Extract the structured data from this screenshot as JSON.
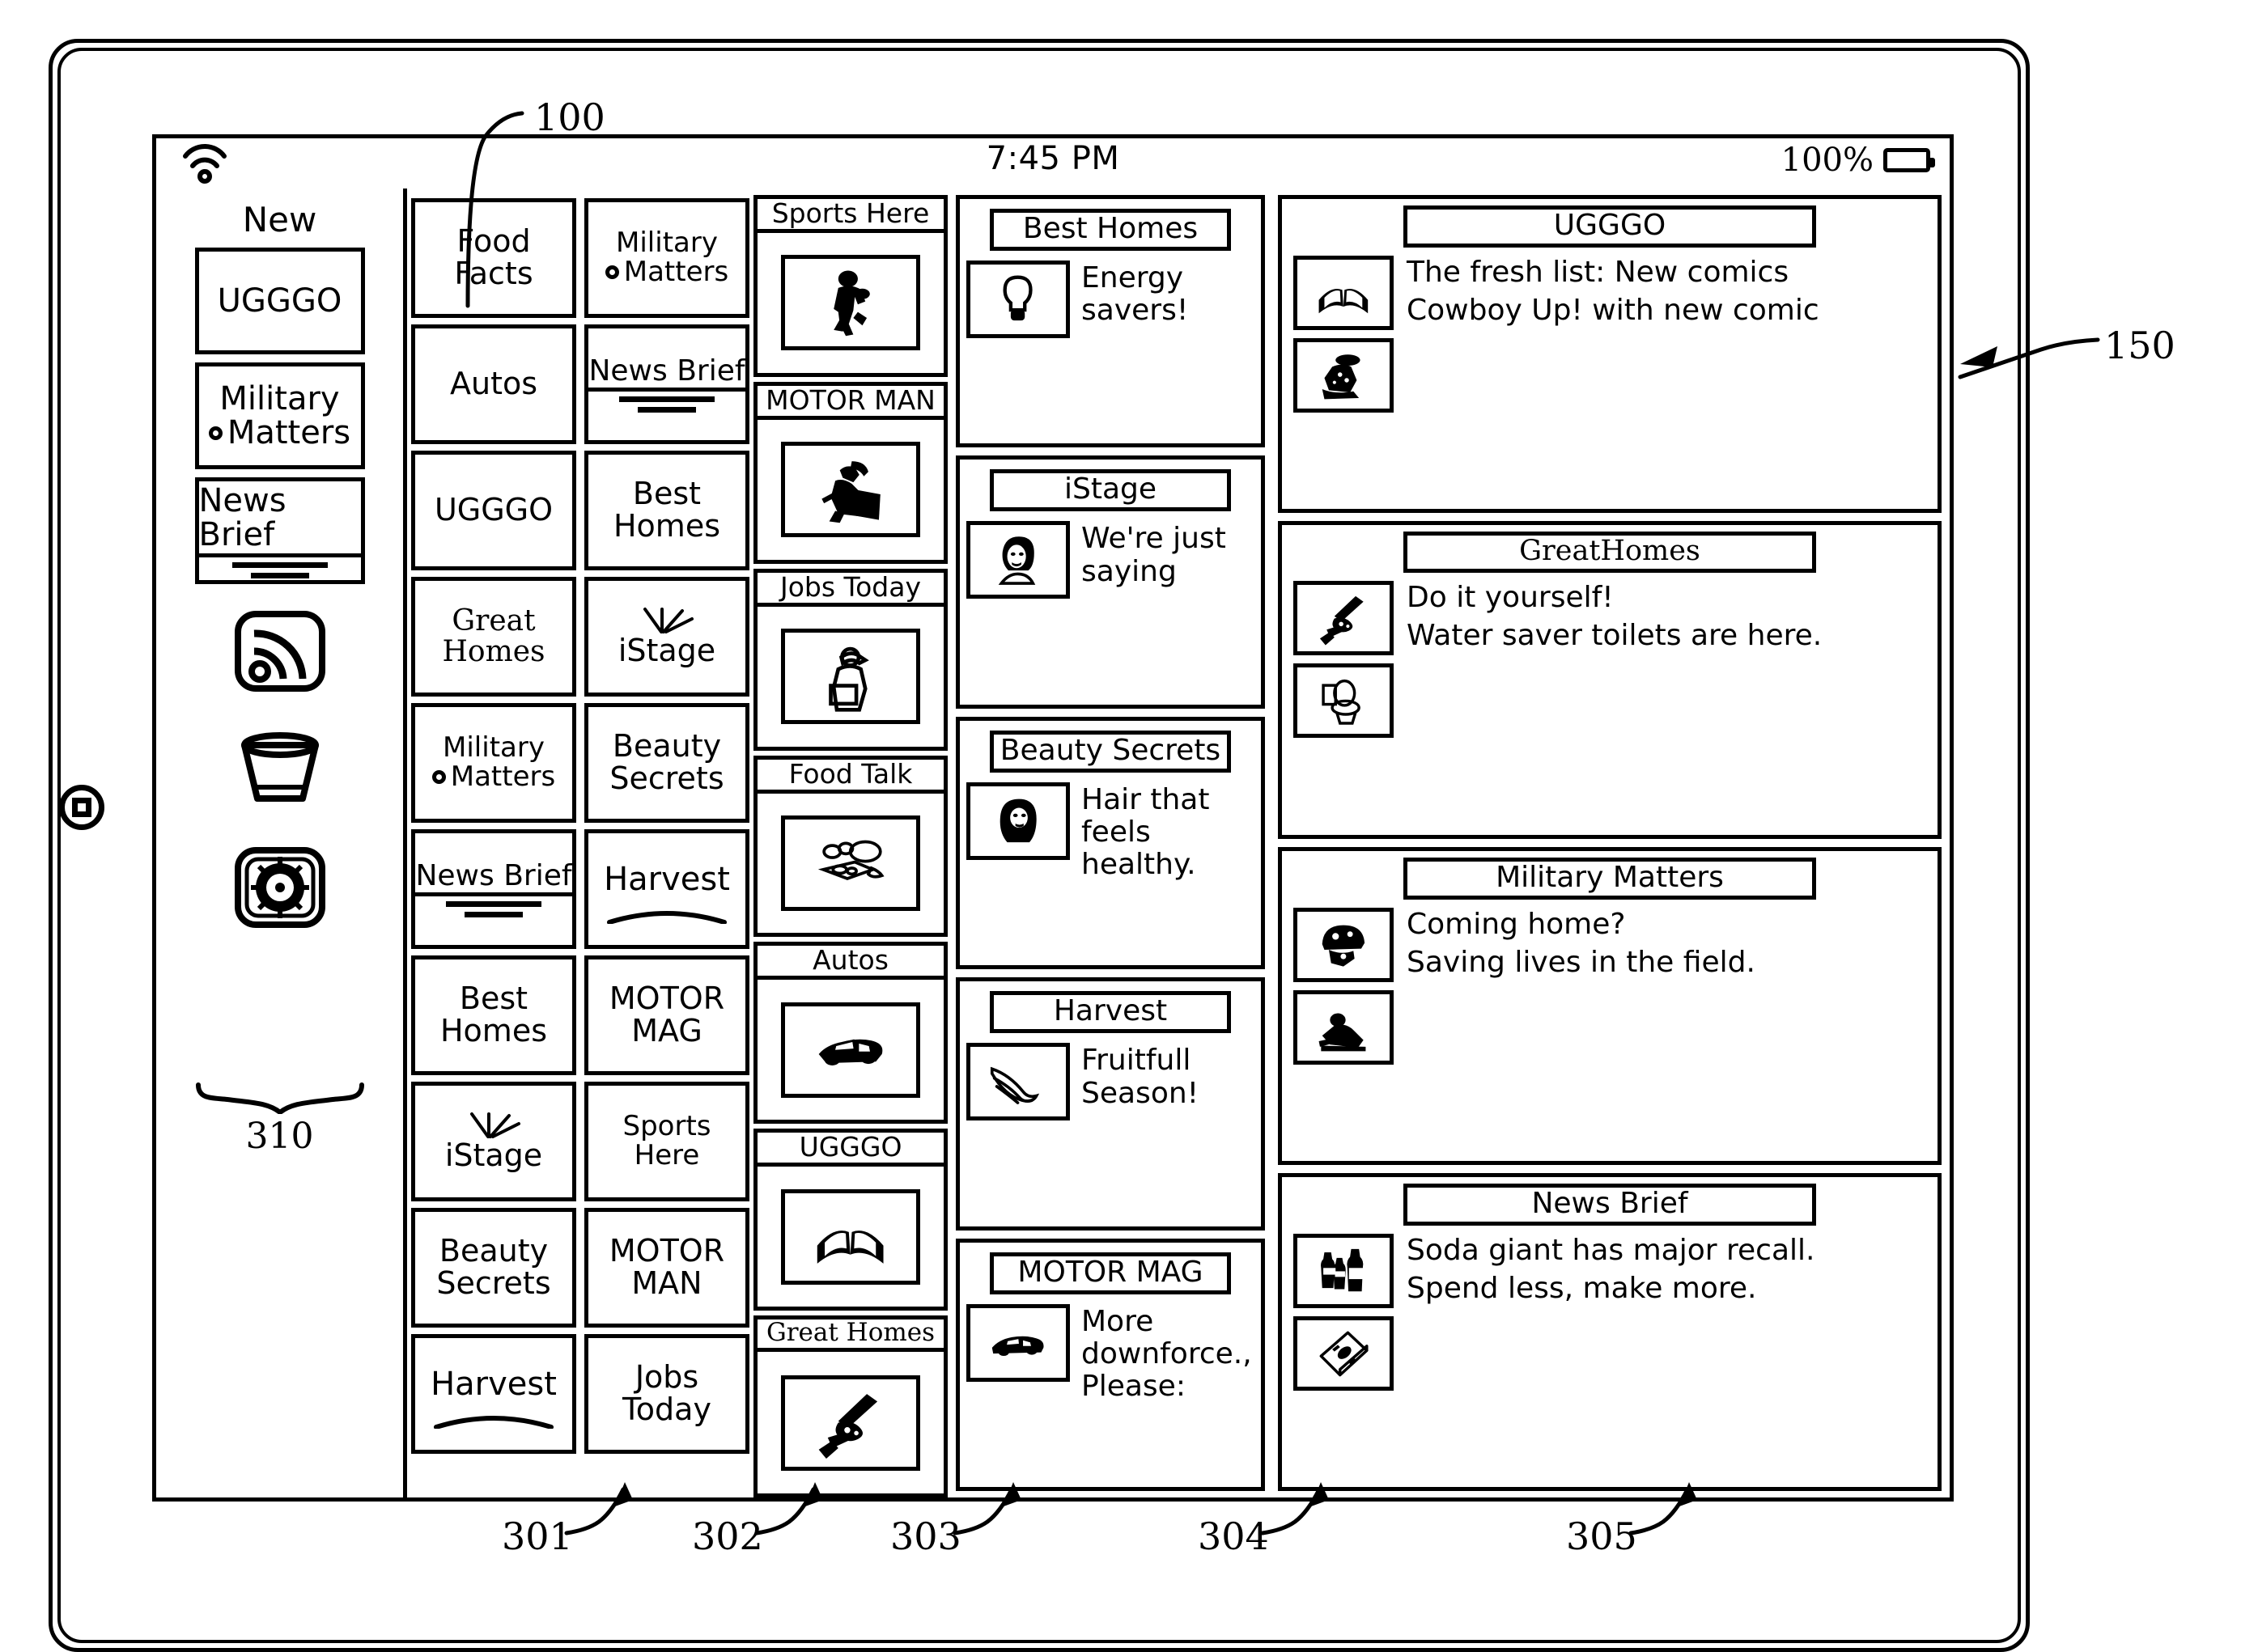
{
  "figure": {
    "device_ref": "100",
    "screen_ref": "150",
    "sidebar_ref": "310",
    "column_refs": [
      "301",
      "302",
      "303",
      "304",
      "305"
    ]
  },
  "status_bar": {
    "wifi_icon": "wifi-icon",
    "time": "7:45 PM",
    "battery_percent": "100%",
    "battery_icon": "battery-icon"
  },
  "sidebar": {
    "title": "New",
    "cards": [
      {
        "line1": "UGGGO",
        "style": "plain"
      },
      {
        "line1": "Military",
        "line2": "Matters",
        "style": "bullet"
      },
      {
        "line1": "News Brief",
        "style": "underlined"
      }
    ],
    "icons": [
      {
        "name": "rss-icon",
        "label": "RSS"
      },
      {
        "name": "trash-icon",
        "label": "Trash"
      },
      {
        "name": "settings-gear-icon",
        "label": "Settings"
      }
    ],
    "group_label": "310"
  },
  "column_301": {
    "ref": "301",
    "tiles": [
      {
        "line1": "Food",
        "line2": "Facts"
      },
      {
        "line1": "Autos"
      },
      {
        "line1": "UGGGO"
      },
      {
        "line1": "Great",
        "line2": "Homes",
        "style": "serif"
      },
      {
        "line1": "Military",
        "line2": "Matters",
        "style": "bullet"
      },
      {
        "line1": "News Brief",
        "style": "underlined"
      },
      {
        "line1": "Best",
        "line2": "Homes"
      },
      {
        "line1": "iStage",
        "style": "istage"
      },
      {
        "line1": "Beauty",
        "line2": "Secrets"
      },
      {
        "line1": "Harvest",
        "style": "arc"
      }
    ]
  },
  "column_302": {
    "ref": "302",
    "tiles": [
      {
        "line1": "Military",
        "line2": "Matters",
        "style": "bullet"
      },
      {
        "line1": "News Brief",
        "style": "underlined"
      },
      {
        "line1": "Best",
        "line2": "Homes"
      },
      {
        "line1": "iStage",
        "style": "istage"
      },
      {
        "line1": "Beauty",
        "line2": "Secrets"
      },
      {
        "line1": "Harvest",
        "style": "arc"
      },
      {
        "line1": "MOTOR",
        "line2": "MAG"
      },
      {
        "line1": "Sports",
        "line2": "Here"
      },
      {
        "line1": "MOTOR",
        "line2": "MAN"
      },
      {
        "line1": "Jobs",
        "line2": "Today"
      }
    ]
  },
  "column_303": {
    "ref": "303",
    "cards": [
      {
        "header": "Sports Here",
        "image": "football-player-icon"
      },
      {
        "header": "MOTOR MAN",
        "image": "mechanic-icon"
      },
      {
        "header": "Jobs Today",
        "image": "worker-delivery-icon"
      },
      {
        "header": "Food Talk",
        "image": "food-platter-icon"
      },
      {
        "header": "Autos",
        "image": "sports-car-icon"
      },
      {
        "header": "UGGGO",
        "image": "open-book-icon"
      },
      {
        "header": "Great Homes",
        "image": "hand-tool-icon",
        "style": "serif"
      }
    ]
  },
  "column_304": {
    "ref": "304",
    "cards": [
      {
        "header": "Best Homes",
        "thumb": "lightbulb-icon",
        "headline": "Energy savers!"
      },
      {
        "header": "iStage",
        "thumb": "woman-face-icon",
        "headline": "We're just saying"
      },
      {
        "header": "Beauty Secrets",
        "thumb": "woman-hair-icon",
        "headline": "Hair that feels healthy."
      },
      {
        "header": "Harvest",
        "thumb": "bananas-icon",
        "headline": "Fruitfull Season!"
      },
      {
        "header": "MOTOR MAG",
        "thumb": "sports-car-icon",
        "headline": "More downforce., Please:"
      }
    ]
  },
  "column_305": {
    "ref": "305",
    "cards": [
      {
        "header": "UGGGO",
        "style": "plain",
        "items": [
          {
            "thumb": "open-book-icon",
            "text": "The fresh list: New comics"
          },
          {
            "thumb": "cowboy-rider-icon",
            "text": "Cowboy Up! with new comic"
          }
        ]
      },
      {
        "header": "GreatHomes",
        "style": "serif",
        "items": [
          {
            "thumb": "hand-tool-icon",
            "text": "Do it yourself!"
          },
          {
            "thumb": "toilet-icon",
            "text": "Water saver toilets are here."
          }
        ]
      },
      {
        "header": "Military Matters",
        "style": "plain",
        "items": [
          {
            "thumb": "soldier-helmet-icon",
            "text": "Coming home?"
          },
          {
            "thumb": "prone-soldier-icon",
            "text": "Saving lives in the field."
          }
        ]
      },
      {
        "header": "News Brief",
        "style": "plain",
        "items": [
          {
            "thumb": "soda-bottles-icon",
            "text": "Soda giant has major recall."
          },
          {
            "thumb": "money-phone-icon",
            "text": "Spend less, make more."
          }
        ]
      }
    ]
  }
}
